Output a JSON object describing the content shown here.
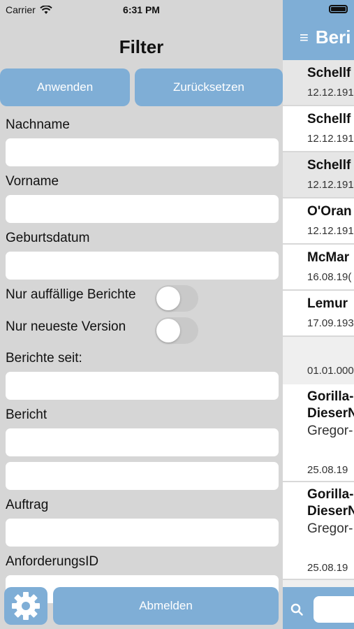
{
  "status": {
    "carrier": "Carrier",
    "time": "6:31 PM"
  },
  "filter": {
    "title": "Filter",
    "apply_label": "Anwenden",
    "reset_label": "Zurücksetzen",
    "fields": {
      "nachname": "Nachname",
      "vorname": "Vorname",
      "geburtsdatum": "Geburtsdatum",
      "berichte_seit": "Berichte seit:",
      "bericht": "Bericht",
      "auftrag": "Auftrag",
      "anforderungsid": "AnforderungsID"
    },
    "toggles": {
      "nur_auffaellige": {
        "label": "Nur auffällige Berichte",
        "on": false
      },
      "nur_neueste": {
        "label": "Nur neueste Version",
        "on": false
      }
    },
    "logout_label": "Abmelden"
  },
  "list": {
    "title": "Beri",
    "rows": [
      {
        "name": "Schellf",
        "date": "12.12.191"
      },
      {
        "name": "Schellf",
        "date": "12.12.191"
      },
      {
        "name": "Schellf",
        "date": "12.12.191"
      },
      {
        "name": "O'Oran",
        "date": "12.12.191"
      },
      {
        "name": "McMar",
        "date": "16.08.19("
      },
      {
        "name": "Lemur",
        "date": "17.09.193"
      }
    ],
    "gap_date": "01.01.000",
    "rows2": [
      {
        "name1": "Gorilla-",
        "name2": "DieserN",
        "sub": "Gregor-",
        "date": "25.08.19"
      },
      {
        "name1": "Gorilla-",
        "name2": "DieserN",
        "sub": "Gregor-",
        "date": "25.08.19"
      }
    ]
  },
  "icons": {
    "wifi": "wifi-icon",
    "gear": "gear-icon",
    "search": "search-icon",
    "menu": "menu-icon",
    "battery": "battery-icon"
  },
  "colors": {
    "accent": "#7faed6",
    "panel_bg": "#d6d6d6"
  }
}
